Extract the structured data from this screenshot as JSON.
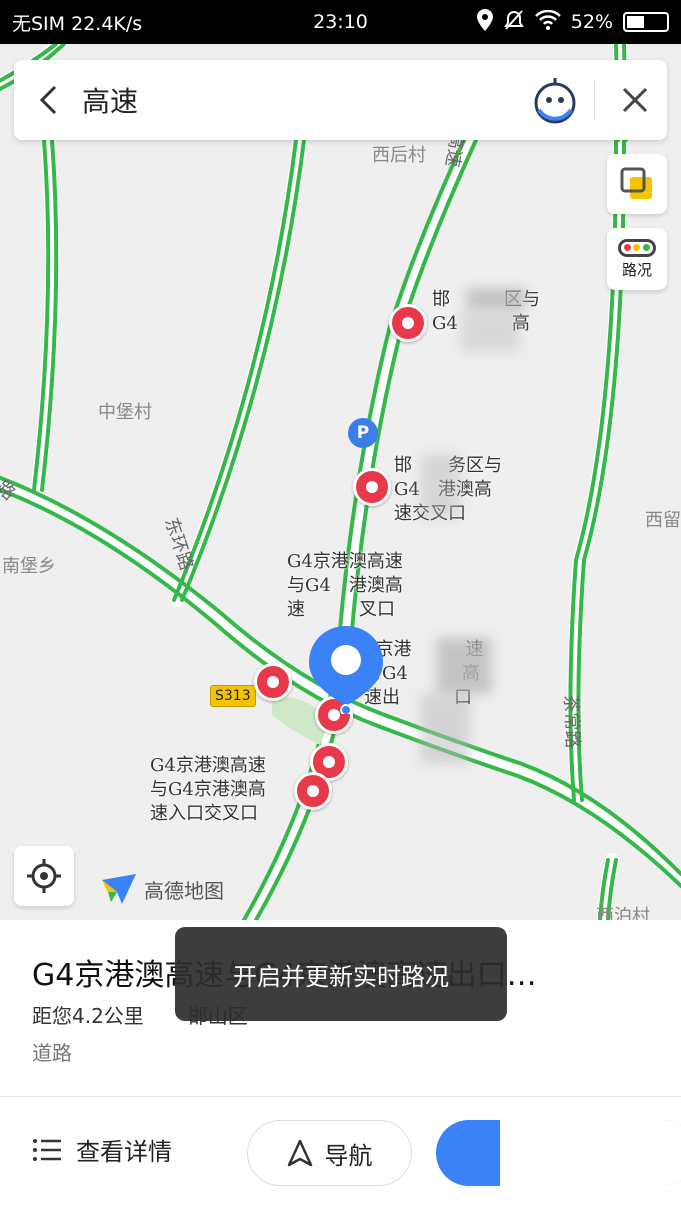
{
  "status_bar": {
    "carrier": "无SIM",
    "speed": "22.4K/s",
    "time": "23:10",
    "battery": "52%"
  },
  "search": {
    "query": "高速"
  },
  "map": {
    "traffic_label": "路况",
    "brand": "高德地图",
    "road_badge": "S313",
    "places": [
      "西后村",
      "中堡村",
      "南堡乡",
      "西留",
      "西泊村"
    ],
    "roads": [
      "东环路",
      "茶常路",
      "高速",
      "路",
      "陵"
    ],
    "pois": [
      {
        "lines": [
          "邯　　　区与",
          "G4　　　高"
        ]
      },
      {
        "lines": [
          "邯　　务区与",
          "G4　港澳高",
          "速交叉口"
        ]
      },
      {
        "lines": [
          "G4京港澳高速",
          "与G4　港澳高",
          "速　　　叉口"
        ]
      },
      {
        "lines": [
          "4京港　　　速",
          "与G4　　　高",
          "速出　　　口"
        ]
      },
      {
        "lines": [
          "G4京港澳高速",
          "与G4京港澳高",
          "速入口交叉口"
        ]
      }
    ]
  },
  "result": {
    "title": "G4京港澳高速与G4京港澳高速出口…",
    "distance": "距您4.2公里",
    "district": "邯山区",
    "category": "道路"
  },
  "toast": "开启并更新实时路况",
  "actions": {
    "details": "查看详情",
    "navigate": "导航"
  },
  "colors": {
    "road_green": "#35b84a",
    "marker_red": "#e8394b",
    "pin_blue": "#3b82f6"
  }
}
